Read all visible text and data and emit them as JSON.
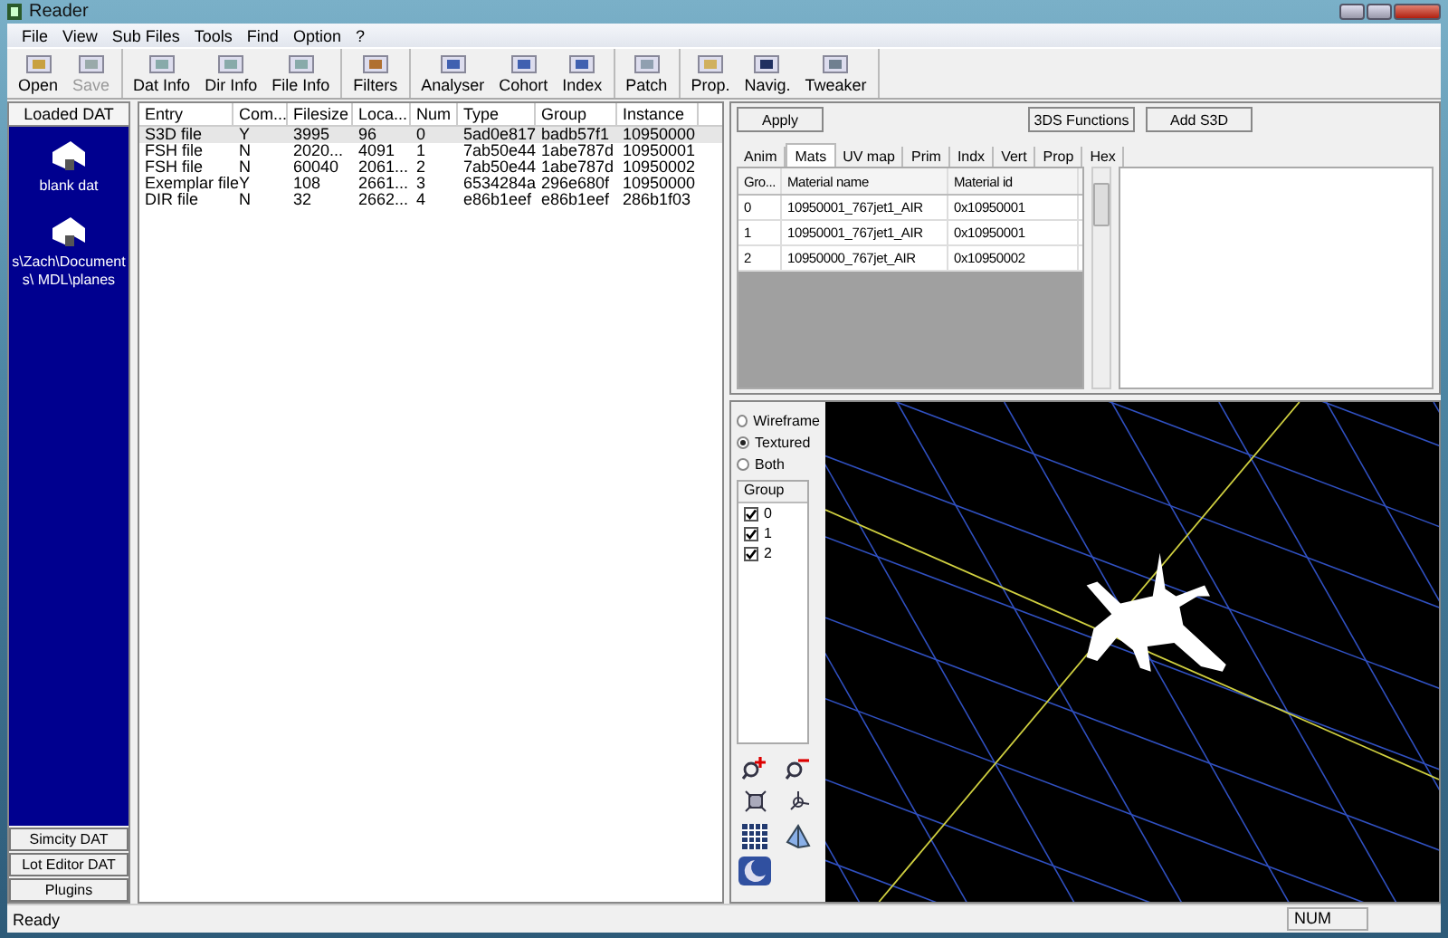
{
  "window": {
    "title": "Reader"
  },
  "menu": [
    "File",
    "View",
    "Sub Files",
    "Tools",
    "Find",
    "Option",
    "?"
  ],
  "toolbar": [
    [
      {
        "label": "Open",
        "disabled": false
      },
      {
        "label": "Save",
        "disabled": true
      }
    ],
    [
      {
        "label": "Dat Info",
        "disabled": false
      },
      {
        "label": "Dir Info",
        "disabled": false
      },
      {
        "label": "File Info",
        "disabled": false
      }
    ],
    [
      {
        "label": "Filters",
        "disabled": false
      }
    ],
    [
      {
        "label": "Analyser",
        "disabled": false
      },
      {
        "label": "Cohort",
        "disabled": false
      },
      {
        "label": "Index",
        "disabled": false
      }
    ],
    [
      {
        "label": "Patch",
        "disabled": false
      }
    ],
    [
      {
        "label": "Prop.",
        "disabled": false
      },
      {
        "label": "Navig.",
        "disabled": false
      },
      {
        "label": "Tweaker",
        "disabled": false
      }
    ]
  ],
  "sidebar": {
    "header": "Loaded DAT",
    "items": [
      {
        "label": "blank dat"
      },
      {
        "label": "s\\Zach\\Documents\\ MDL\\planes"
      }
    ],
    "buttons": [
      "Simcity DAT",
      "Lot Editor DAT",
      "Plugins"
    ]
  },
  "file_list": {
    "columns": [
      "Entry",
      "Com...",
      "Filesize",
      "Loca...",
      "Num",
      "Type",
      "Group",
      "Instance"
    ],
    "rows": [
      {
        "selected": true,
        "cells": [
          "S3D file",
          "Y",
          "3995",
          "96",
          "0",
          "5ad0e817",
          "badb57f1",
          "10950000"
        ]
      },
      {
        "selected": false,
        "cells": [
          "FSH file",
          "N",
          "2020...",
          "4091",
          "1",
          "7ab50e44",
          "1abe787d",
          "10950001"
        ]
      },
      {
        "selected": false,
        "cells": [
          "FSH file",
          "N",
          "60040",
          "2061...",
          "2",
          "7ab50e44",
          "1abe787d",
          "10950002"
        ]
      },
      {
        "selected": false,
        "cells": [
          "Exemplar file",
          "Y",
          "108",
          "2661...",
          "3",
          "6534284a",
          "296e680f",
          "10950000"
        ]
      },
      {
        "selected": false,
        "cells": [
          "DIR file",
          "N",
          "32",
          "2662...",
          "4",
          "e86b1eef",
          "e86b1eef",
          "286b1f03"
        ]
      }
    ]
  },
  "editor": {
    "apply": "Apply",
    "functions": "3DS Functions",
    "add": "Add S3D",
    "tabs": [
      {
        "label": "Anim",
        "selected": false
      },
      {
        "label": "Mats",
        "selected": true
      },
      {
        "label": "UV map",
        "selected": false
      },
      {
        "label": "Prim",
        "selected": false
      },
      {
        "label": "Indx",
        "selected": false
      },
      {
        "label": "Vert",
        "selected": false
      },
      {
        "label": "Prop",
        "selected": false
      },
      {
        "label": "Hex",
        "selected": false
      }
    ],
    "materials": {
      "columns": [
        "Gro...",
        "Material name",
        "Material id"
      ],
      "rows": [
        [
          "0",
          "10950001_767jet1_AIR",
          "0x10950001"
        ],
        [
          "1",
          "10950001_767jet1_AIR",
          "0x10950001"
        ],
        [
          "2",
          "10950000_767jet_AIR",
          "0x10950002"
        ]
      ]
    }
  },
  "view_modes": [
    {
      "label": "Wireframe",
      "selected": false
    },
    {
      "label": "Textured",
      "selected": true
    },
    {
      "label": "Both",
      "selected": false
    }
  ],
  "groups": {
    "header": "Group",
    "items": [
      {
        "label": "0",
        "checked": true
      },
      {
        "label": "1",
        "checked": true
      },
      {
        "label": "2",
        "checked": true
      }
    ]
  },
  "status_bar": {
    "text": "Ready",
    "indicator": "NUM"
  }
}
